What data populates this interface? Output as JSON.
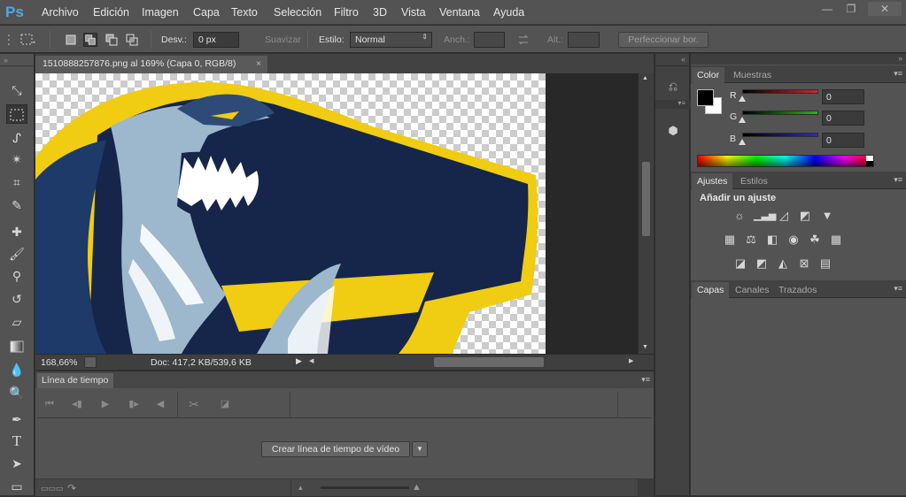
{
  "menubar": {
    "logo": "Ps",
    "items": [
      "Archivo",
      "Edición",
      "Imagen",
      "Capa",
      "Texto",
      "Selección",
      "Filtro",
      "3D",
      "Vista",
      "Ventana",
      "Ayuda"
    ],
    "window_controls": {
      "minimize": "—",
      "restore": "❐",
      "close": "✕"
    }
  },
  "options": {
    "feather_label": "Desv.:",
    "feather_value": "0 px",
    "antialias_label": "Suavizar",
    "style_label": "Estilo:",
    "style_value": "Normal",
    "width_label": "Anch.:",
    "height_label": "Alt.:",
    "refine_button": "Perfeccionar bor."
  },
  "document": {
    "tab_title": "1510888257876.png al 169% (Capa 0, RGB/8)",
    "close": "×",
    "zoom": "168,66%",
    "doc_info": "Doc: 417,2 KB/539,6 KB"
  },
  "timeline": {
    "tab": "Línea de tiempo",
    "create_button": "Crear línea de tiempo de vídeo"
  },
  "color_panel": {
    "tabs": [
      "Color",
      "Muestras"
    ],
    "channels": [
      {
        "label": "R",
        "value": "0",
        "color": "#cc2a2a"
      },
      {
        "label": "G",
        "value": "0",
        "color": "#2ab02a"
      },
      {
        "label": "B",
        "value": "0",
        "color": "#2a2acc"
      }
    ],
    "foreground": "#000000",
    "background": "#ffffff"
  },
  "adjustments_panel": {
    "tabs": [
      "Ajustes",
      "Estilos"
    ],
    "heading": "Añadir un ajuste"
  },
  "layers_panel": {
    "tabs": [
      "Capas",
      "Canales",
      "Trazados"
    ]
  },
  "colors": {
    "artwork_navy": "#15264a",
    "artwork_yellow": "#f0cc12"
  }
}
